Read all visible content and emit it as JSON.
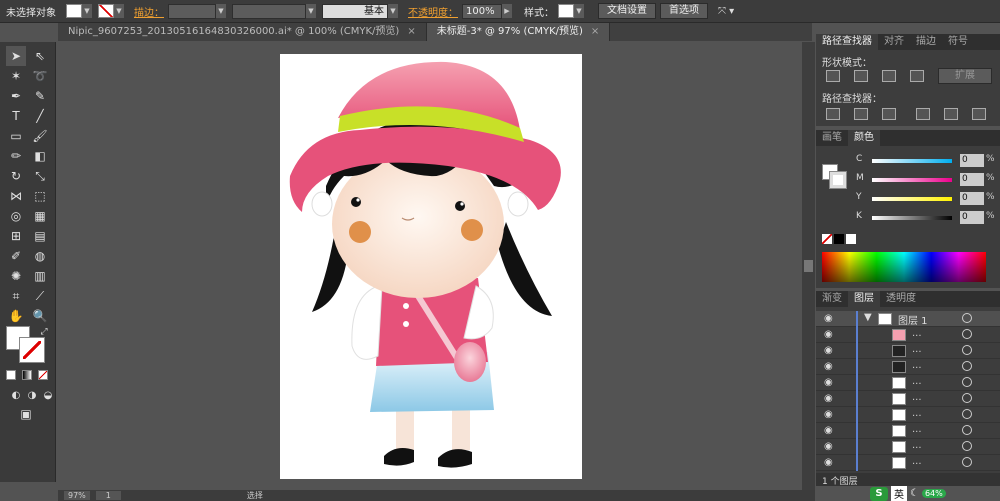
{
  "control_bar": {
    "selection_label": "未选择对象",
    "stroke_label": "描边：",
    "opacity_label": "不透明度：",
    "opacity_value": "100%",
    "stroke_style": "基本",
    "style_label": "样式：",
    "doc_setup_btn": "文档设置",
    "prefs_btn": "首选项"
  },
  "doc_tabs": [
    {
      "label": "Nipic_9607253_20130516164830326000.ai* @ 100% (CMYK/预览)",
      "close": "×"
    },
    {
      "label": "未标题-3* @ 97% (CMYK/预览)",
      "close": "×"
    }
  ],
  "status": {
    "zoom": "97%",
    "page": "1",
    "mode": "选择"
  },
  "pathfinder_panel": {
    "tabs": [
      "路径查找器",
      "对齐",
      "描边",
      "符号"
    ],
    "shape_modes_label": "形状模式：",
    "pathfinders_label": "路径查找器：",
    "expand_btn": "扩展"
  },
  "color_panel": {
    "tabs": [
      "画笔",
      "颜色"
    ],
    "channels": [
      {
        "letter": "C",
        "value": "0",
        "unit": "%"
      },
      {
        "letter": "M",
        "value": "0",
        "unit": "%"
      },
      {
        "letter": "Y",
        "value": "0",
        "unit": "%"
      },
      {
        "letter": "K",
        "value": "0",
        "unit": "%"
      }
    ]
  },
  "layers_panel": {
    "tabs": [
      "渐变",
      "图层",
      "透明度"
    ],
    "layer_name": "图层 1",
    "sublayer_dots": "...",
    "footer_count": "1 个图层"
  },
  "ime": {
    "lang": "英",
    "battery": "64%"
  },
  "colors": {
    "hat": "#e6527a",
    "hat_band": "#c8e028",
    "skirt": "#a8d8ee",
    "cheek": "#e0904a"
  }
}
